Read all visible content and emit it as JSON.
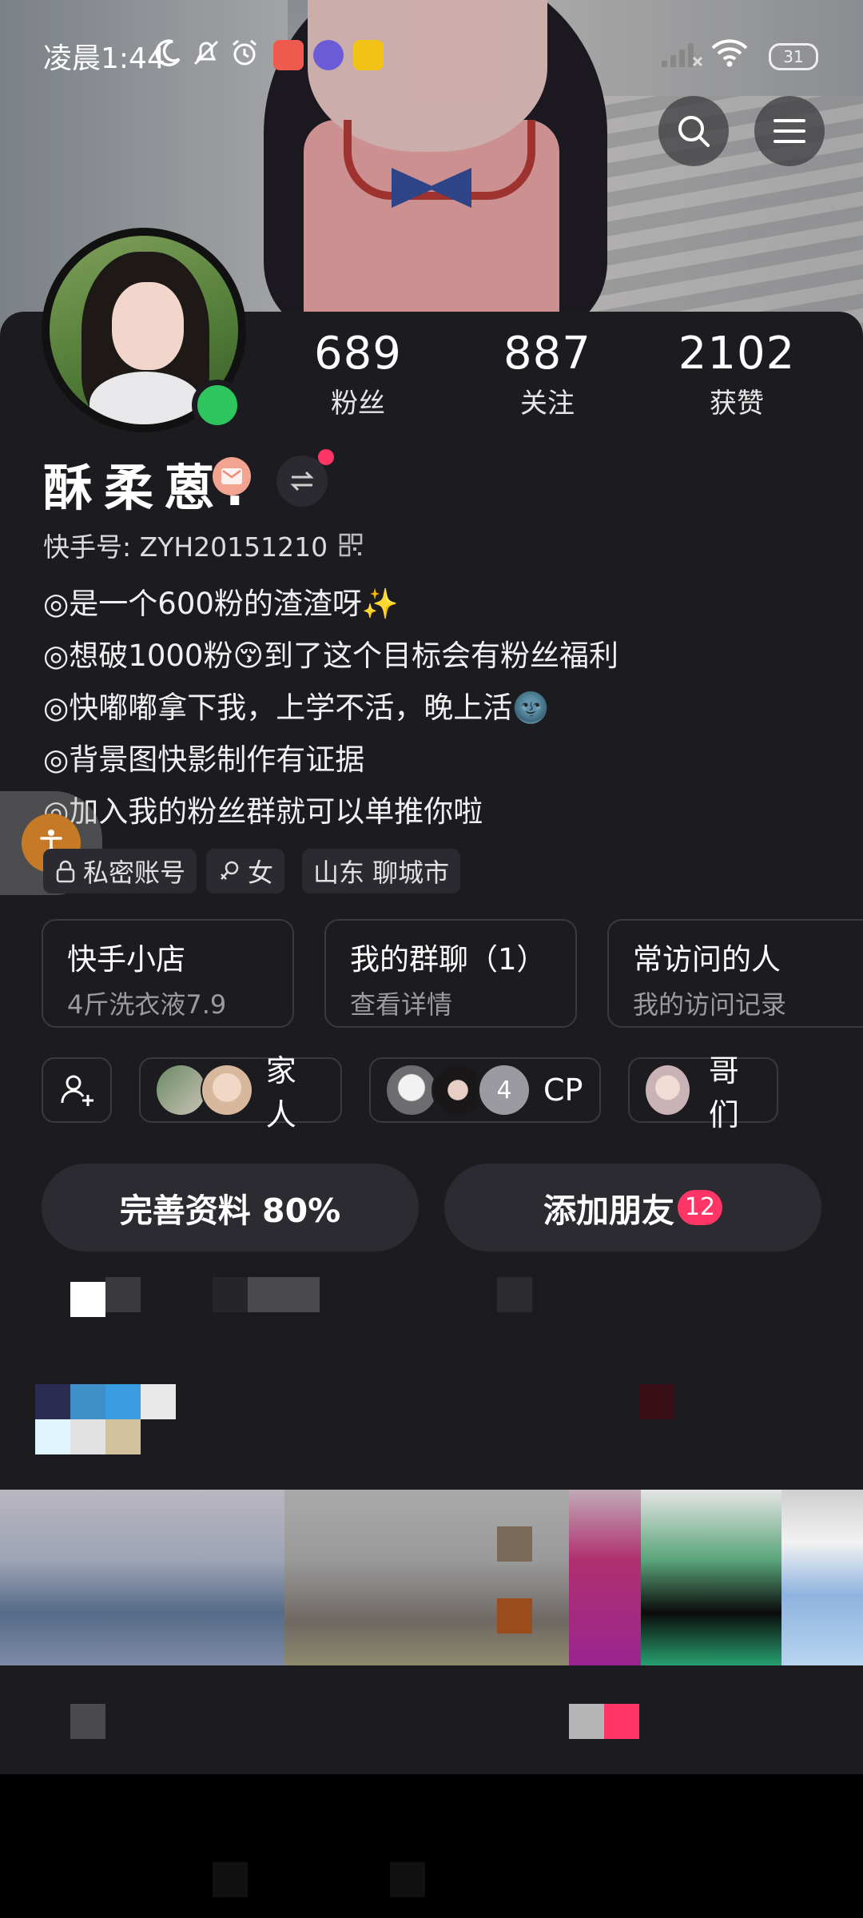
{
  "status_bar": {
    "time": "凌晨1:44",
    "battery": "31"
  },
  "profile": {
    "name": "酥柔蒽.",
    "kuaishou_id": "快手号: ZYH20151210",
    "stats": [
      {
        "num": "689",
        "label": "粉丝"
      },
      {
        "num": "887",
        "label": "关注"
      },
      {
        "num": "2102",
        "label": "获赞"
      }
    ],
    "bio": [
      "◎是一个600粉的渣渣呀✨",
      "◎想破1000粉😚到了这个目标会有粉丝福利",
      "◎快嘟嘟拿下我，上学不活，晚上活🌚",
      "◎背景图快影制作有证据",
      "◎加入我的粉丝群就可以单推你啦"
    ],
    "tags": [
      "私密账号",
      "女",
      "山东 聊城市"
    ]
  },
  "cards": [
    {
      "title": "快手小店",
      "sub": "4斤洗衣液7.9"
    },
    {
      "title": "我的群聊（1）",
      "sub": "查看详情"
    },
    {
      "title": "常访问的人",
      "sub": "我的访问记录"
    }
  ],
  "groups": {
    "family": "家人",
    "cp_count": "4",
    "cp": "CP",
    "brothers": "哥们"
  },
  "actions": {
    "complete": "完善资料 80%",
    "add_friend": "添加朋友",
    "add_friend_count": "12"
  },
  "colors": {
    "background": "#1c1b20",
    "accent": "#fe3565",
    "online": "#2ec65f"
  }
}
